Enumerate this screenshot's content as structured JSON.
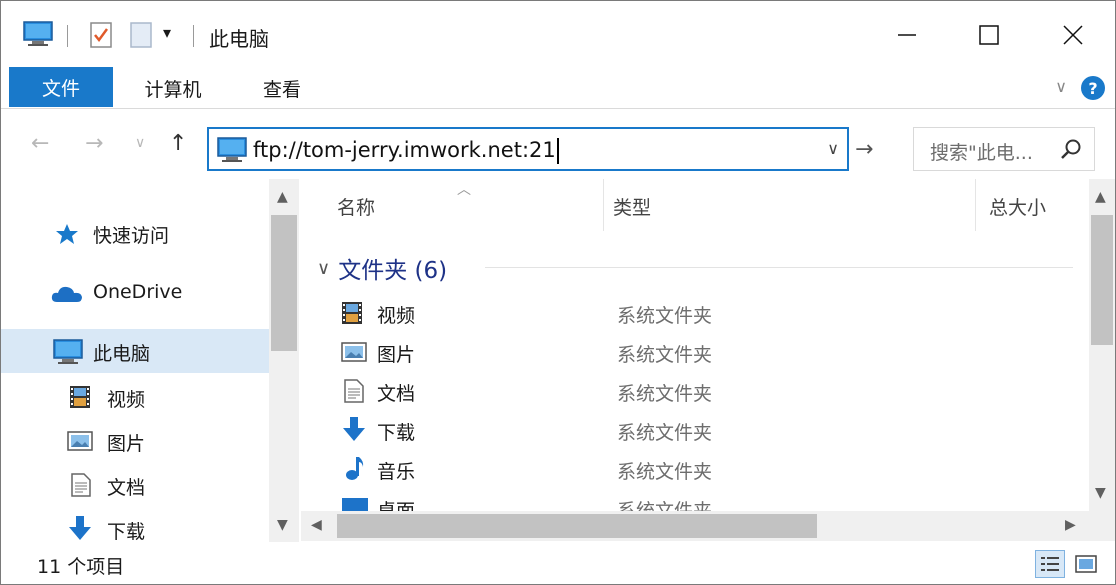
{
  "window": {
    "title": "此电脑",
    "quick_access_dropdown": "▾"
  },
  "ribbon": {
    "tabs": [
      "文件",
      "计算机",
      "查看"
    ],
    "help": "?"
  },
  "navbar": {
    "address_value": "ftp://tom-jerry.imwork.net:21",
    "search_placeholder": "搜索\"此电...",
    "back": "←",
    "forward": "→",
    "recent": "∨",
    "up": "↑",
    "go": "→"
  },
  "nav_pane": {
    "items": [
      {
        "label": "快速访问",
        "icon": "star-icon"
      },
      {
        "label": "OneDrive",
        "icon": "cloud-icon"
      },
      {
        "label": "此电脑",
        "icon": "computer-icon",
        "selected": true
      },
      {
        "label": "视频",
        "icon": "video-icon"
      },
      {
        "label": "图片",
        "icon": "pictures-icon"
      },
      {
        "label": "文档",
        "icon": "documents-icon"
      },
      {
        "label": "下载",
        "icon": "download-icon"
      }
    ]
  },
  "content": {
    "columns": [
      "名称",
      "类型",
      "总大小"
    ],
    "group": {
      "label": "文件夹 (6)"
    },
    "rows": [
      {
        "name": "视频",
        "type": "系统文件夹",
        "icon": "video-icon"
      },
      {
        "name": "图片",
        "type": "系统文件夹",
        "icon": "pictures-icon"
      },
      {
        "name": "文档",
        "type": "系统文件夹",
        "icon": "documents-icon"
      },
      {
        "name": "下载",
        "type": "系统文件夹",
        "icon": "download-icon"
      },
      {
        "name": "音乐",
        "type": "系统文件夹",
        "icon": "music-icon"
      },
      {
        "name": "桌面",
        "type": "系统文件夹",
        "icon": "desktop-icon"
      }
    ]
  },
  "status": {
    "item_count": "11 个项目"
  },
  "colors": {
    "accent": "#1979ca",
    "selection": "#d9e8f6",
    "group_header": "#1e3287"
  }
}
